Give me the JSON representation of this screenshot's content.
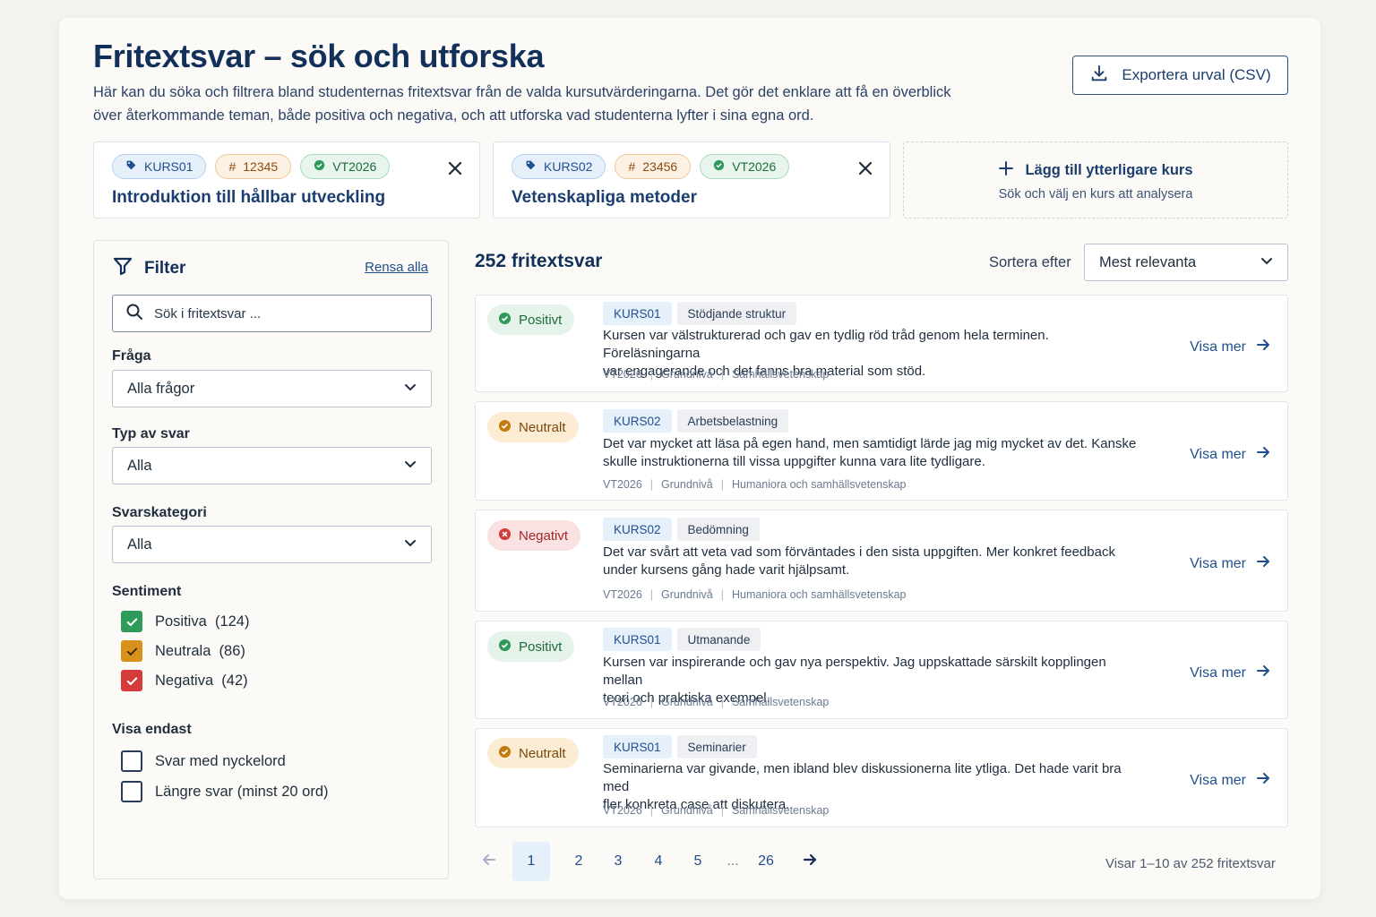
{
  "header": {
    "title": "Fritextsvar – sök och utforska",
    "description": "Här kan du söka och filtrera bland studenternas fritextsvar  från de valda kursutvärderingarna. Det gör det enklare att få en överblick över återkommande teman, både positiva och negativa, och att utforska vad studenterna lyfter i sina egna ord.",
    "export_label": "Exportera urval (CSV)"
  },
  "courses": [
    {
      "code": "KURS01",
      "number": "12345",
      "term": "VT2026",
      "name": "Introduktion till hållbar utveckling"
    },
    {
      "code": "KURS02",
      "number": "23456",
      "term": "VT2026",
      "name": "Vetenskapliga metoder"
    }
  ],
  "add_course": {
    "title": "Lägg till ytterligare kurs",
    "subtitle": "Sök och välj en kurs att analysera"
  },
  "filter": {
    "title": "Filter",
    "clear_all": "Rensa alla",
    "search_placeholder": "Sök i fritextsvar ...",
    "question_label": "Fråga",
    "question_value": "Alla frågor",
    "type_label": "Typ av svar",
    "type_value": "Alla",
    "category_label": "Svarskategori",
    "category_value": "Alla",
    "sentiment_label": "Sentiment",
    "sentiments": [
      {
        "label": "Positiva",
        "count": "(124)",
        "checked": true,
        "color": "#2e9b5a"
      },
      {
        "label": "Neutrala",
        "count": "(86)",
        "checked": true,
        "color": "#d8911b"
      },
      {
        "label": "Negativa",
        "count": "(42)",
        "checked": true,
        "color": "#d63b3b"
      }
    ],
    "show_only_label": "Visa endast",
    "show_only": [
      {
        "label": "Svar med nyckelord",
        "checked": false
      },
      {
        "label": "Längre svar (minst 20 ord)",
        "checked": false
      }
    ]
  },
  "results": {
    "count_label": "252 fritextsvar",
    "sort_label": "Sortera efter",
    "sort_value": "Mest relevanta",
    "view_more": "Visa mer",
    "items": [
      {
        "sentiment": "Positivt",
        "kind": "positive",
        "code": "KURS01",
        "topic": "Stödjande struktur",
        "line1": "Kursen var välstrukturerad och gav en tydlig röd tråd genom hela terminen. Föreläsningarna",
        "line2": "var engagerande och det fanns bra material som stöd.",
        "term": "VT2026",
        "level": "Grundnivå",
        "area": "Samhällsvetenskap"
      },
      {
        "sentiment": "Neutralt",
        "kind": "neutral",
        "code": "KURS02",
        "topic": "Arbetsbelastning",
        "line1": "Det var mycket att läsa på egen hand, men samtidigt lärde jag mig mycket av det. Kanske",
        "line2": "skulle instruktionerna till vissa uppgifter kunna vara lite tydligare.",
        "term": "VT2026",
        "level": "Grundnivå",
        "area": "Humaniora och samhällsvetenskap"
      },
      {
        "sentiment": "Negativt",
        "kind": "negative",
        "code": "KURS02",
        "topic": "Bedömning",
        "line1": "Det var svårt att veta vad som förväntades i den sista uppgiften. Mer konkret feedback",
        "line2": "under kursens gång hade varit hjälpsamt.",
        "term": "VT2026",
        "level": "Grundnivå",
        "area": "Humaniora och samhällsvetenskap"
      },
      {
        "sentiment": "Positivt",
        "kind": "positive",
        "code": "KURS01",
        "topic": "Utmanande",
        "line1": "Kursen var inspirerande och gav nya perspektiv. Jag uppskattade särskilt kopplingen mellan",
        "line2": "teori och praktiska exempel.",
        "term": "VT2026",
        "level": "Grundnivå",
        "area": "Samhällsvetenskap"
      },
      {
        "sentiment": "Neutralt",
        "kind": "neutral",
        "code": "KURS01",
        "topic": "Seminarier",
        "line1": "Seminarierna var givande, men ibland blev diskussionerna lite ytliga. Det hade varit bra med",
        "line2": "fler konkreta case att diskutera.",
        "term": "VT2026",
        "level": "Grundnivå",
        "area": "Samhällsvetenskap"
      }
    ]
  },
  "pagination": {
    "current": "1",
    "pages": [
      "1",
      "2",
      "3",
      "4",
      "5",
      "...",
      "26"
    ],
    "summary": "Visar 1–10 av 252 fritextsvar"
  },
  "colors": {
    "primary": "#1c3e6e",
    "accent": "#1f4f8c",
    "positive": "#2e9b5a",
    "neutral": "#d8911b",
    "negative": "#d63b3b"
  }
}
